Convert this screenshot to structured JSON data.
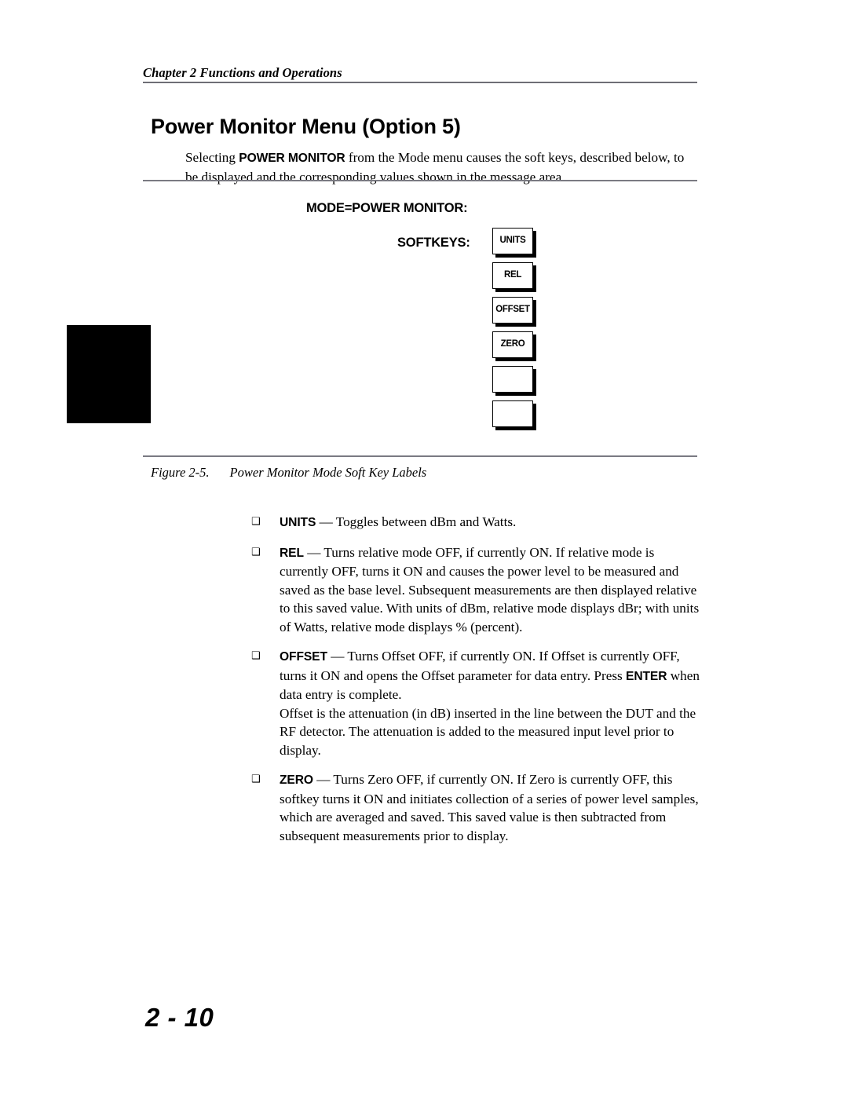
{
  "header": {
    "chapter_line": "Chapter 2 Functions and Operations"
  },
  "section": {
    "title": "Power Monitor Menu (Option 5)"
  },
  "intro": {
    "before_bold": "Selecting ",
    "bold": "POWER MONITOR",
    "after_bold": " from the Mode menu causes the soft keys, described below, to be displayed and the corresponding values shown in the message area."
  },
  "figure": {
    "mode_label": "MODE=POWER MONITOR:",
    "softkeys_label": "SOFTKEYS:",
    "softkeys": [
      {
        "label": "UNITS"
      },
      {
        "label": "REL"
      },
      {
        "label": "OFFSET"
      },
      {
        "label": "ZERO"
      },
      {
        "label": ""
      },
      {
        "label": ""
      }
    ],
    "caption_number": "Figure 2-5.",
    "caption_text": "Power Monitor Mode Soft Key Labels"
  },
  "bullets": [
    {
      "marker": "❑",
      "keyword": "UNITS",
      "text": " — Toggles between dBm and Watts."
    },
    {
      "marker": "❑",
      "keyword": "REL",
      "text": " — Turns relative mode OFF, if currently ON. If relative mode is currently OFF, turns it ON and causes the power level to be measured and saved as the base level. Subsequent measurements are then displayed relative to this saved value. With units of dBm, relative mode displays dBr; with units of Watts, relative mode displays % (percent)."
    },
    {
      "marker": "❑",
      "keyword": "OFFSET",
      "text": " — Turns Offset OFF, if currently ON. If Offset is currently OFF, turns it ON and opens the Offset parameter for data entry. Press ",
      "keyword2": "ENTER",
      "text2": " when data entry is complete.",
      "para2": "Offset is the attenuation (in dB) inserted in the line between the DUT and the RF detector. The attenuation is added to the measured input level prior to display."
    },
    {
      "marker": "❑",
      "keyword": "ZERO",
      "text": " — Turns Zero OFF, if currently ON. If Zero is currently OFF, this softkey turns it ON and initiates collection of a series of power level samples, which are averaged and saved. This saved value is then subtracted from subsequent measurements prior to display."
    }
  ],
  "footer": {
    "page_number": "2 - 10"
  }
}
